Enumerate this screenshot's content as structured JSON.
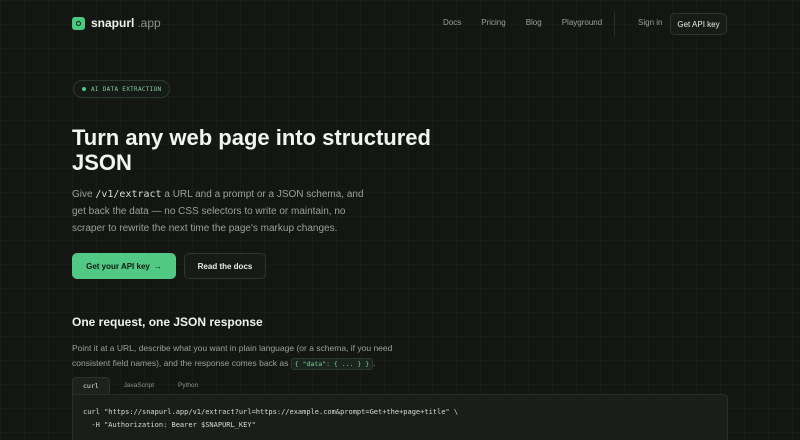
{
  "brand": {
    "name": "snapurl",
    "tld": ".app"
  },
  "nav": {
    "links": [
      "Docs",
      "Pricing",
      "Blog",
      "Playground"
    ],
    "signin": "Sign in",
    "api_key": "Get API key"
  },
  "hero": {
    "badge": "AI DATA EXTRACTION",
    "title": "Turn any web page into structured JSON",
    "desc_pre": "Give ",
    "desc_code": "/v1/extract",
    "desc_post": " a URL and a prompt or a JSON schema, and get back the data — no CSS selectors to write or maintain, no scraper to rewrite the next time the page's markup changes.",
    "cta_primary": "Get your API key",
    "cta_primary_arrow": "→",
    "cta_secondary": "Read the docs"
  },
  "section": {
    "title": "One request, one JSON response",
    "desc_pre": "Point it at a URL, describe what you want in plain language (or a schema, if you need consistent field names), and the response comes back as ",
    "desc_code": "{ \"data\": { ... } }",
    "desc_post": "."
  },
  "code": {
    "tabs": [
      "curl",
      "JavaScript",
      "Python"
    ],
    "active_tab": "curl",
    "lines": [
      "curl \"https://snapurl.app/v1/extract?url=https://example.com&prompt=Get+the+page+title\" \\",
      "  -H \"Authorization: Bearer $SNAPURL_KEY\""
    ]
  },
  "colors": {
    "accent": "#52c885",
    "background": "#131613"
  }
}
